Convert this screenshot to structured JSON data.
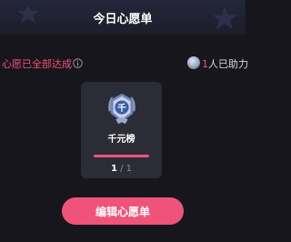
{
  "header": {
    "title": "今日心愿单"
  },
  "status": {
    "text": "心愿已全部达成",
    "helpers_count": "1",
    "helpers_suffix": "人已助力"
  },
  "wish_card": {
    "badge_glyph": "千",
    "label": "千元榜",
    "progress_fraction": 1.0,
    "current": "1",
    "separator": " / ",
    "total": "1"
  },
  "actions": {
    "edit_label": "编辑心愿单"
  },
  "colors": {
    "accent": "#f0537a",
    "background": "#17161d",
    "card": "#2c2c37"
  }
}
